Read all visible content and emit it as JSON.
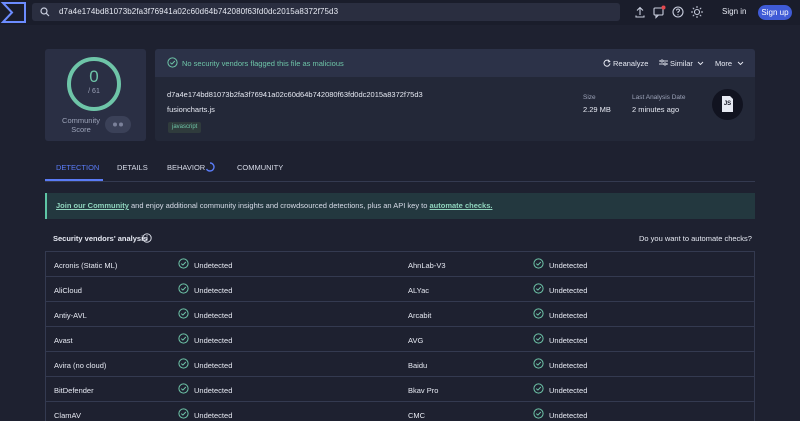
{
  "search": {
    "value": "d7a4e174bd81073b2fa3f76941a02c60d64b742080f63fd0dc2015a8372f75d3"
  },
  "auth": {
    "signin": "Sign in",
    "signup": "Sign up"
  },
  "score": {
    "value": "0",
    "total": "/ 61",
    "label": "Community Score"
  },
  "banner": {
    "text": "No security vendors flagged this file as malicious",
    "reanalyze": "Reanalyze",
    "similar": "Similar",
    "more": "More"
  },
  "file": {
    "hash": "d7a4e174bd81073b2fa3f76941a02c60d64b742080f63fd0dc2015a8372f75d3",
    "name": "fusioncharts.js",
    "tag": "javascript",
    "size_label": "Size",
    "size_value": "2.29 MB",
    "analysis_label": "Last Analysis Date",
    "analysis_value": "2 minutes ago",
    "type_icon": "JS"
  },
  "tabs": [
    "DETECTION",
    "DETAILS",
    "BEHAVIOR",
    "COMMUNITY"
  ],
  "alert": {
    "link1": "Join our Community",
    "text": " and enjoy additional community insights and crowdsourced detections, plus an API key to ",
    "link2": "automate checks."
  },
  "analysis": {
    "title": "Security vendors' analysis",
    "automate_question": "Do you want to automate checks?",
    "rows": [
      {
        "v1": "Acronis (Static ML)",
        "r1": "Undetected",
        "v2": "AhnLab-V3",
        "r2": "Undetected"
      },
      {
        "v1": "AliCloud",
        "r1": "Undetected",
        "v2": "ALYac",
        "r2": "Undetected"
      },
      {
        "v1": "Antiy-AVL",
        "r1": "Undetected",
        "v2": "Arcabit",
        "r2": "Undetected"
      },
      {
        "v1": "Avast",
        "r1": "Undetected",
        "v2": "AVG",
        "r2": "Undetected"
      },
      {
        "v1": "Avira (no cloud)",
        "r1": "Undetected",
        "v2": "Baidu",
        "r2": "Undetected"
      },
      {
        "v1": "BitDefender",
        "r1": "Undetected",
        "v2": "Bkav Pro",
        "r2": "Undetected"
      },
      {
        "v1": "ClamAV",
        "r1": "Undetected",
        "v2": "CMC",
        "r2": "Undetected"
      }
    ]
  },
  "colors": {
    "accent": "#5a7bf5",
    "clean": "#6ec5a8",
    "background": "#1e2130",
    "signup": "#3f5bd6"
  }
}
